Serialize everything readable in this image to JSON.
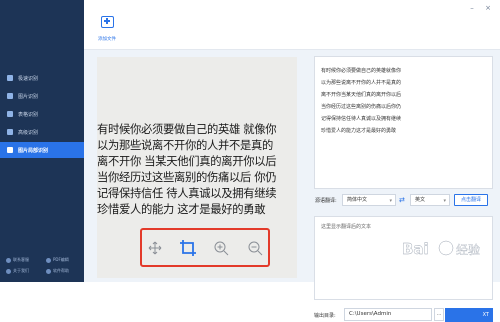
{
  "sidebar": {
    "items": [
      {
        "label": "极速识别",
        "active": false
      },
      {
        "label": "图片识别",
        "active": false
      },
      {
        "label": "表格识别",
        "active": false
      },
      {
        "label": "高级识别",
        "active": false
      },
      {
        "label": "图片局部识别",
        "active": true
      }
    ],
    "bottom_links": [
      {
        "label": "联系客服"
      },
      {
        "label": "PDF编辑"
      },
      {
        "label": "关于我们"
      },
      {
        "label": "软件帮助"
      }
    ]
  },
  "toolbar": {
    "add_file_label": "添加文件"
  },
  "image": {
    "lines": [
      "有时候你必须要做自己的英雄 就像你",
      "以为那些说离不开你的人并不是真的",
      "离不开你 当某天他们真的离开你以后",
      "当你经历过这些离别的伤痛以后 你仍",
      "记得保持信任 待人真诚以及拥有继续",
      "珍惜爱人的能力 这才是最好的勇敢"
    ]
  },
  "image_tools": [
    "move-icon",
    "crop-icon",
    "zoom-in-icon",
    "zoom-out-icon"
  ],
  "result": {
    "lines": [
      "有时候你必须要做自己的英雄就像你",
      "以为那些说离不开你的人并不是真的",
      "离不开你当某天他们真的离开你以后",
      "当你经历过这些离别的伤痛以后你仍",
      "记得保持信任待人真诚以及拥有继续",
      "珍惜爱人的能力这才是最好的勇敢"
    ]
  },
  "translate": {
    "label": "源语翻译:",
    "from_lang": "简体中文",
    "to_lang": "英文",
    "button": "点击翻译",
    "placeholder": "这里显示翻译后的文本"
  },
  "output": {
    "label": "输出目录:",
    "path": "C:\\Users\\Admin",
    "browse": "...",
    "export_partial": "XT"
  },
  "colors": {
    "sidebar_bg": "#1d3456",
    "accent": "#2a73e8",
    "highlight": "#e33a2a"
  }
}
